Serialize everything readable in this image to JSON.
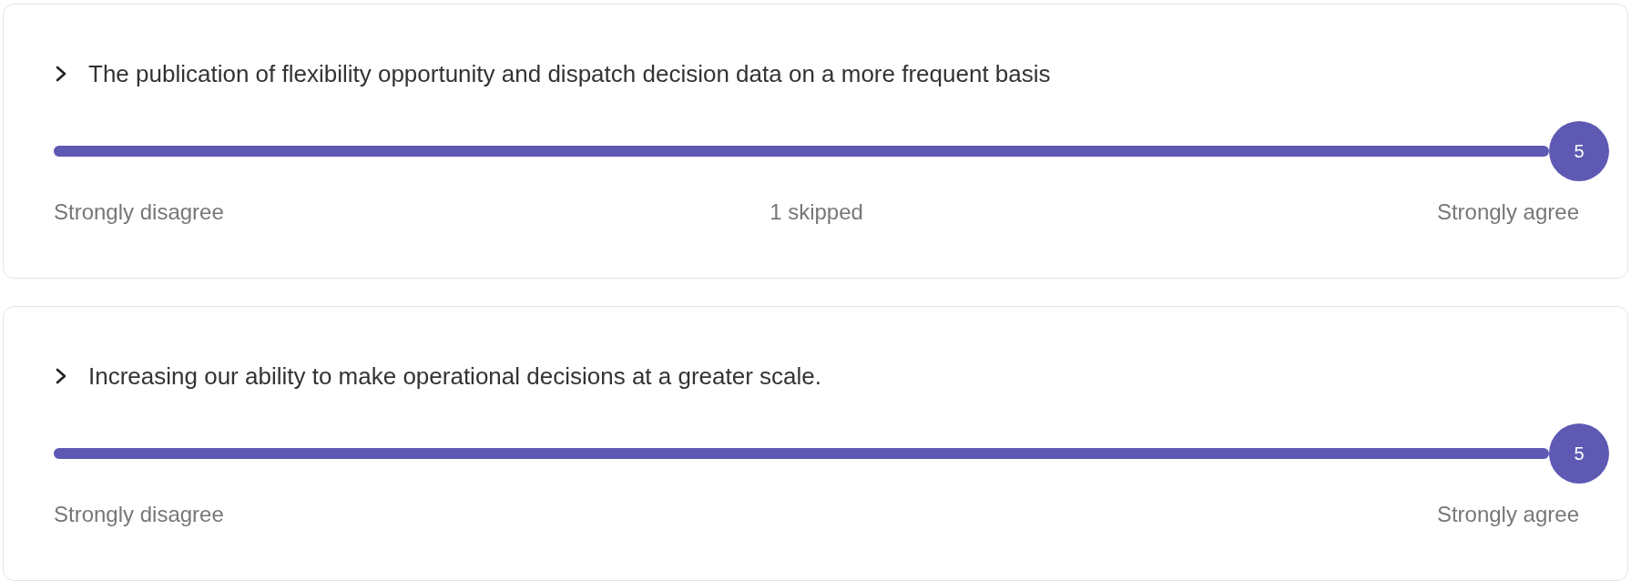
{
  "questions": [
    {
      "title": "The publication of flexibility opportunity and dispatch decision data on a more frequent basis",
      "expanded": false,
      "level": 1,
      "value": "5",
      "min_label": "Strongly disagree",
      "skipped": "1 skipped",
      "max_label": "Strongly agree"
    },
    {
      "title": "Increasing our ability to make operational decisions at a greater scale.",
      "expanded": false,
      "level": 1,
      "value": "5",
      "min_label": "Strongly disagree",
      "max_label": "Strongly agree"
    }
  ]
}
